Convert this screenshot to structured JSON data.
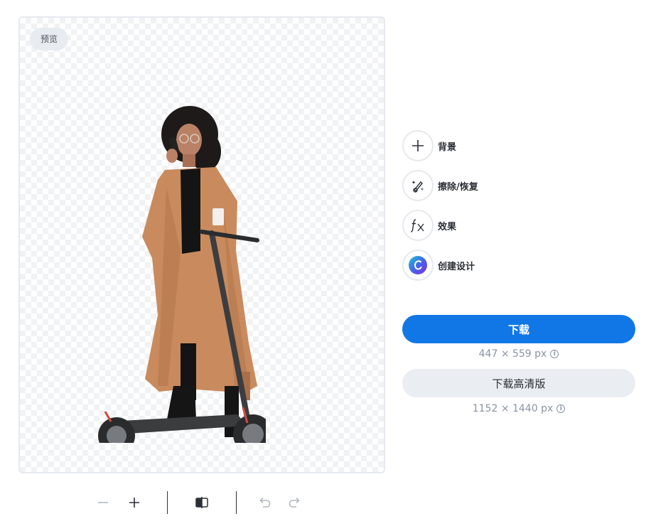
{
  "preview": {
    "badge": "预览"
  },
  "tools": [
    {
      "label": "背景",
      "icon": "plus-icon"
    },
    {
      "label": "擦除/恢复",
      "icon": "magic-brush-icon"
    },
    {
      "label": "效果",
      "icon": "fx-icon"
    },
    {
      "label": "创建设计",
      "icon": "canva-logo-icon"
    }
  ],
  "download": {
    "label": "下载",
    "size": "447 × 559 px",
    "color": "#1277e6"
  },
  "download_hd": {
    "label": "下载高清版",
    "size": "1152 × 1440 px"
  },
  "toolbar": {
    "icons": [
      "zoom-out-icon",
      "zoom-in-icon",
      "compare-icon",
      "undo-icon",
      "redo-icon"
    ]
  }
}
